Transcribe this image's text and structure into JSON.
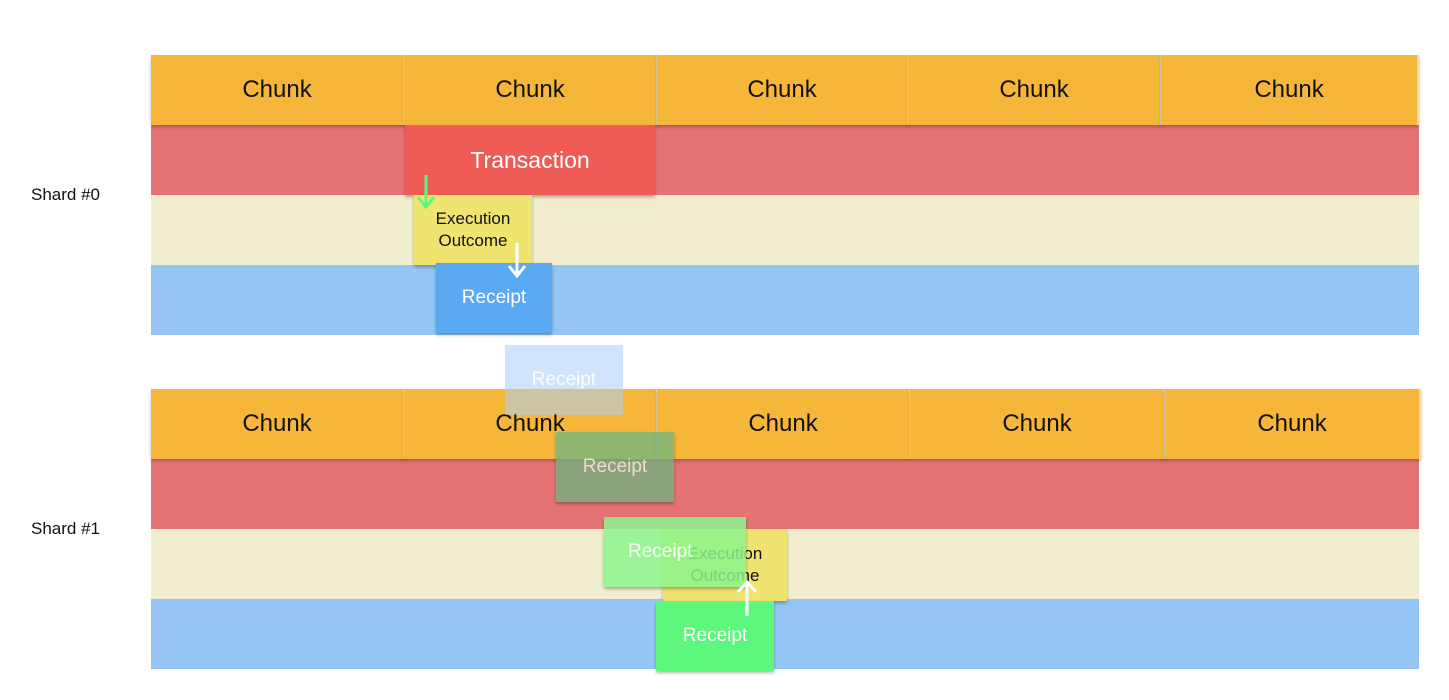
{
  "diagram": {
    "shards": [
      {
        "label": "Shard #0",
        "chunks": [
          "Chunk",
          "Chunk",
          "Chunk",
          "Chunk",
          "Chunk"
        ],
        "items": {
          "transaction": "Transaction",
          "execution_outcome": "Execution\nOutcome",
          "receipt": "Receipt"
        }
      },
      {
        "label": "Shard #1",
        "chunks": [
          "Chunk",
          "Chunk",
          "Chunk",
          "Chunk",
          "Chunk"
        ],
        "items": {
          "receipt_transit_1": "Receipt",
          "receipt_transit_2": "Receipt",
          "receipt_transit_3": "Receipt",
          "execution_outcome": "Execution\nOutcome",
          "receipt": "Receipt"
        }
      }
    ],
    "colors": {
      "chunk": "#f5b63a",
      "transaction_band": "#e57373",
      "transaction": "#ef5b55",
      "execution_outcome_band": "#f1edcf",
      "execution_outcome": "#efe46f",
      "receipt_band": "#94c5f5",
      "receipt_shard0": "#5aaaf3",
      "receipt_shard1": "#5ef77e",
      "arrow_green": "#5ef77e",
      "arrow_white": "#ffffff"
    }
  }
}
